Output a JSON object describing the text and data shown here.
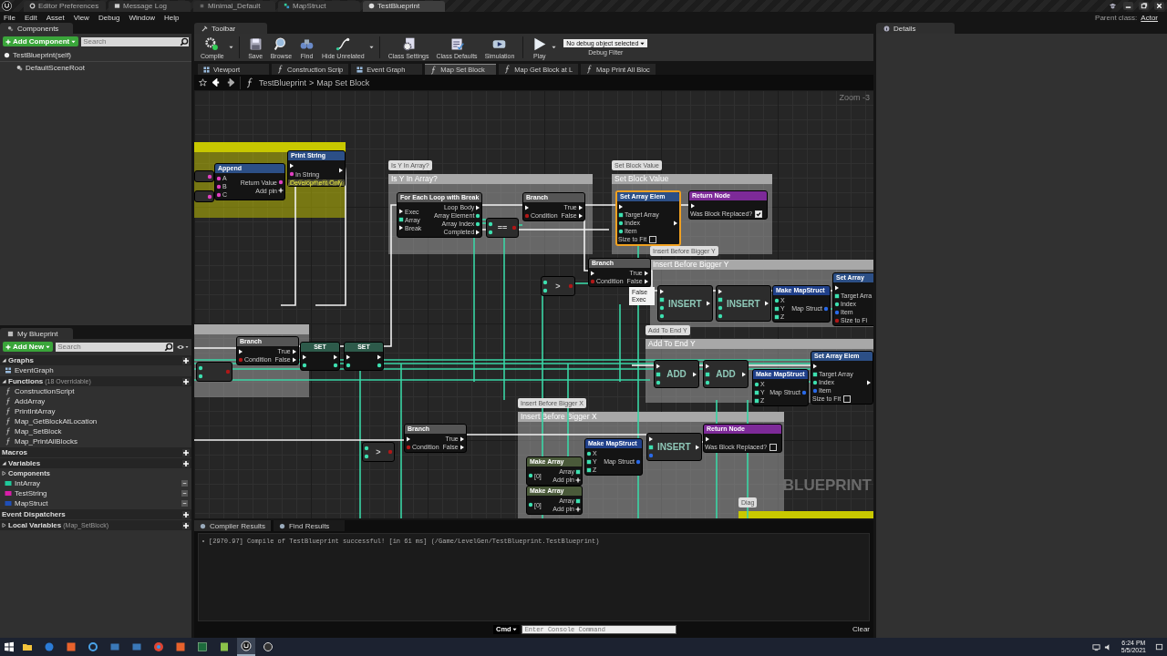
{
  "title_bar": {
    "tabs": [
      {
        "label": "Editor Preferences",
        "kind": "settings",
        "selected": false
      },
      {
        "label": "Message Log",
        "kind": "log",
        "selected": false
      },
      {
        "label": "Minimal_Default",
        "kind": "level",
        "selected": false
      },
      {
        "label": "MapStruct",
        "kind": "struct",
        "selected": false
      },
      {
        "label": "TestBlueprint",
        "kind": "blueprint",
        "selected": true
      }
    ]
  },
  "menu": [
    "File",
    "Edit",
    "Asset",
    "View",
    "Debug",
    "Window",
    "Help"
  ],
  "parent_class": {
    "label": "Parent class:",
    "value": "Actor"
  },
  "components": {
    "tab": "Components",
    "add_button": "Add Component",
    "search": {
      "placeholder": "Search"
    },
    "tree": [
      {
        "label": "TestBlueprint(self)",
        "kind": "self",
        "children": [
          {
            "label": "DefaultSceneRoot",
            "kind": "scene"
          }
        ]
      }
    ]
  },
  "my_blueprint": {
    "tab": "My Blueprint",
    "add_button": "Add New",
    "search": {
      "placeholder": "Search"
    },
    "sections": [
      {
        "title": "Graphs",
        "expanded": true,
        "items": [
          {
            "label": "EventGraph",
            "kind": "graph"
          }
        ]
      },
      {
        "title": "Functions",
        "note": "(18 Overridable)",
        "expanded": true,
        "items": [
          {
            "label": "ConstructionScript",
            "kind": "construction"
          },
          {
            "label": "AddArray",
            "kind": "function"
          },
          {
            "label": "PrintIntArray",
            "kind": "function"
          },
          {
            "label": "Map_GetBlockAtLocation",
            "kind": "function"
          },
          {
            "label": "Map_SetBlock",
            "kind": "function"
          },
          {
            "label": "Map_PrintAllBlocks",
            "kind": "function"
          }
        ]
      },
      {
        "title": "Macros"
      },
      {
        "title": "Variables",
        "expanded": true,
        "items": [
          {
            "label": "Components",
            "kind": "category"
          },
          {
            "label": "IntArray",
            "kind": "variable",
            "color": "#1fc99a"
          },
          {
            "label": "TestString",
            "kind": "variable",
            "color": "#d81ea8"
          },
          {
            "label": "MapStruct",
            "kind": "variable",
            "color": "#1f4fb8"
          }
        ]
      },
      {
        "title": "Event Dispatchers"
      },
      {
        "title": "Local Variables",
        "note": "(Map_SetBlock)",
        "expanded": false
      }
    ]
  },
  "toolbar": {
    "tab": "Toolbar",
    "buttons": [
      {
        "label": "Compile",
        "kind": "compile",
        "dropdown": true
      },
      {
        "label": "Save",
        "kind": "save",
        "dropdown": false
      },
      {
        "label": "Browse",
        "kind": "browse",
        "dropdown": false
      },
      {
        "label": "Find",
        "kind": "find",
        "dropdown": false
      },
      {
        "label": "Hide Unrelated",
        "kind": "hide",
        "dropdown": true
      },
      {
        "label": "Class Settings",
        "kind": "settings",
        "dropdown": false
      },
      {
        "label": "Class Defaults",
        "kind": "defaults",
        "dropdown": false
      },
      {
        "label": "Simulation",
        "kind": "simulation",
        "dropdown": false
      },
      {
        "label": "Play",
        "kind": "play",
        "dropdown": true
      }
    ],
    "debug": {
      "value": "No debug object selected",
      "label": "Debug Filter"
    }
  },
  "graph_tabs": [
    {
      "label": "Viewport",
      "kind": "viewport",
      "selected": false
    },
    {
      "label": "Construction Scrip",
      "kind": "function",
      "selected": false
    },
    {
      "label": "Event Graph",
      "kind": "event",
      "selected": false
    },
    {
      "label": "Map Set Block",
      "kind": "function",
      "selected": true
    },
    {
      "label": "Map Get Block at L",
      "kind": "function",
      "selected": false
    },
    {
      "label": "Map Print All Bloc",
      "kind": "function",
      "selected": false
    }
  ],
  "breadcrumb": {
    "parent": "TestBlueprint",
    "separator": ">",
    "current": "Map Set Block"
  },
  "graph": {
    "zoom": "Zoom -3",
    "watermark": "BLUEPRINT",
    "comments": [
      {
        "color": "#c8c800"
      },
      {
        "title": "Is Y In Array?",
        "bubble": "Is Y In Array?",
        "color": "#a8a8a8"
      },
      {
        "title": "Set Block Value",
        "bubble": "Set Block Value",
        "color": "#a8a8a8"
      },
      {
        "title": "Insert Before Bigger Y",
        "bubble": "Insert Before Bigger Y",
        "color": "#a8a8a8"
      },
      {
        "color": "#a8a8a8"
      },
      {
        "title": "Add To End Y",
        "bubble": "Add To End Y",
        "color": "#a8a8a8"
      },
      {
        "title": "Insert Before Bigger X",
        "bubble": "Insert Before Bigger X",
        "color": "#a8a8a8"
      },
      {
        "bubble": "Diag",
        "color": "#c8c800"
      }
    ],
    "nodes": [
      {
        "kind": "stub",
        "selected": false,
        "outputs": [
          {
            "kind": "string"
          }
        ]
      },
      {
        "kind": "stub",
        "selected": false,
        "outputs": [
          {
            "kind": "string"
          }
        ]
      },
      {
        "kind": "function",
        "title": "Append",
        "selected": false,
        "inputs": [
          {
            "label": "A",
            "kind": "string"
          },
          {
            "label": "B",
            "kind": "string"
          },
          {
            "label": "C",
            "kind": "string"
          }
        ],
        "outputs": [
          {
            "label": "Return Value",
            "kind": "string"
          },
          {
            "label": "Add pin",
            "kind": "add"
          }
        ]
      },
      {
        "kind": "function",
        "title": "Print String",
        "selected": false,
        "footer": "Development Only",
        "inputs": [
          {
            "kind": "exec"
          },
          {
            "label": "In String",
            "kind": "string"
          }
        ],
        "outputs": [
          {
            "kind": "exec"
          }
        ]
      },
      {
        "kind": "macro",
        "title": "For Each Loop with Break",
        "selected": false,
        "inputs": [
          {
            "label": "Exec",
            "kind": "exec"
          },
          {
            "label": "Array",
            "kind": "array"
          },
          {
            "label": "Break",
            "kind": "exec"
          }
        ],
        "outputs": [
          {
            "label": "Loop Body",
            "kind": "exec"
          },
          {
            "label": "Array Element",
            "kind": "int"
          },
          {
            "label": "Array Index",
            "kind": "int"
          },
          {
            "label": "Completed",
            "kind": "exec"
          }
        ]
      },
      {
        "kind": "operator",
        "title": "==",
        "selected": false,
        "inputs": [
          {
            "kind": "int"
          },
          {
            "kind": "int"
          }
        ],
        "outputs": [
          {
            "kind": "bool"
          }
        ]
      },
      {
        "kind": "branch",
        "title": "Branch",
        "selected": false,
        "inputs": [
          {
            "kind": "exec"
          },
          {
            "label": "Condition",
            "kind": "bool"
          }
        ],
        "outputs": [
          {
            "label": "True",
            "kind": "exec"
          },
          {
            "label": "False",
            "kind": "exec"
          }
        ]
      },
      {
        "kind": "function",
        "title": "Set Array Elem",
        "selected": true,
        "checkbox": {
          "label": "Size to Fit",
          "checked": false
        },
        "inputs": [
          {
            "kind": "exec"
          },
          {
            "label": "Target Array",
            "kind": "array"
          },
          {
            "label": "Index",
            "kind": "int"
          },
          {
            "label": "Item",
            "kind": "int"
          }
        ],
        "outputs": [
          {
            "kind": "exec"
          }
        ]
      },
      {
        "kind": "return",
        "title": "Return Node",
        "selected": false,
        "checkbox": {
          "label": "Was Block Replaced?",
          "checked": true
        },
        "inputs": [
          {
            "kind": "exec"
          }
        ]
      },
      {
        "kind": "branch",
        "title": "Branch",
        "selected": false,
        "inputs": [
          {
            "kind": "exec"
          },
          {
            "label": "Condition",
            "kind": "bool"
          }
        ],
        "outputs": [
          {
            "label": "True",
            "kind": "exec"
          },
          {
            "label": "False",
            "kind": "exec"
          }
        ]
      },
      {
        "kind": "operator",
        "title": ">",
        "selected": false,
        "inputs": [
          {
            "kind": "int"
          },
          {
            "kind": "int"
          }
        ],
        "outputs": [
          {
            "kind": "bool"
          }
        ]
      },
      {
        "kind": "compact",
        "title": "INSERT",
        "selected": false,
        "inputs": [
          {
            "kind": "exec"
          },
          {
            "kind": "array"
          },
          {
            "kind": "int"
          },
          {
            "kind": "int"
          }
        ],
        "outputs": [
          {
            "kind": "exec"
          }
        ]
      },
      {
        "kind": "compact",
        "title": "INSERT",
        "selected": false,
        "inputs": [
          {
            "kind": "exec"
          },
          {
            "kind": "array"
          },
          {
            "kind": "int"
          },
          {
            "kind": "int"
          }
        ],
        "outputs": [
          {
            "kind": "exec"
          }
        ]
      },
      {
        "kind": "struct",
        "title": "Make MapStruct",
        "selected": false,
        "inputs": [
          {
            "label": "X",
            "kind": "int"
          },
          {
            "label": "Y",
            "kind": "array"
          },
          {
            "label": "Z",
            "kind": "array"
          }
        ],
        "outputs": [
          {
            "label": "Map Struct",
            "kind": "struct"
          }
        ]
      },
      {
        "kind": "function",
        "title": "Set Array",
        "selected": false,
        "inputs": [
          {
            "kind": "exec"
          },
          {
            "label": "Target Arra",
            "kind": "array"
          },
          {
            "label": "Index",
            "kind": "int"
          },
          {
            "label": "Item",
            "kind": "struct"
          },
          {
            "label": "Size to Fi",
            "kind": "bool"
          }
        ]
      },
      {
        "kind": "branch",
        "title": "Branch",
        "selected": false,
        "inputs": [
          {
            "kind": "exec"
          },
          {
            "label": "Condition",
            "kind": "bool"
          }
        ],
        "outputs": [
          {
            "label": "True",
            "kind": "exec"
          },
          {
            "label": "False",
            "kind": "exec"
          }
        ]
      },
      {
        "kind": "operator",
        "selected": false,
        "inputs": [
          {
            "kind": "int"
          },
          {
            "kind": "int"
          }
        ],
        "outputs": [
          {
            "kind": "bool"
          }
        ]
      },
      {
        "kind": "set",
        "title": "SET",
        "selected": false,
        "inputs": [
          {
            "kind": "exec"
          },
          {
            "kind": "int"
          }
        ],
        "outputs": [
          {
            "kind": "exec"
          },
          {
            "kind": "int"
          }
        ]
      },
      {
        "kind": "set",
        "title": "SET",
        "selected": false,
        "inputs": [
          {
            "kind": "exec"
          },
          {
            "kind": "int"
          }
        ],
        "outputs": [
          {
            "kind": "exec"
          },
          {
            "kind": "int"
          }
        ]
      },
      {
        "kind": "compact",
        "title": "ADD",
        "selected": false,
        "inputs": [
          {
            "kind": "exec"
          },
          {
            "kind": "array"
          },
          {
            "kind": "int"
          }
        ],
        "outputs": [
          {
            "kind": "exec"
          }
        ]
      },
      {
        "kind": "compact",
        "title": "ADD",
        "selected": false,
        "inputs": [
          {
            "kind": "exec"
          },
          {
            "kind": "array"
          },
          {
            "kind": "int"
          }
        ],
        "outputs": [
          {
            "kind": "exec"
          }
        ]
      },
      {
        "kind": "struct",
        "title": "Make MapStruct",
        "selected": false,
        "inputs": [
          {
            "label": "X",
            "kind": "int"
          },
          {
            "label": "Y",
            "kind": "array"
          },
          {
            "label": "Z",
            "kind": "array"
          }
        ],
        "outputs": [
          {
            "label": "Map Struct",
            "kind": "struct"
          }
        ]
      },
      {
        "kind": "function",
        "title": "Set Array Elem",
        "selected": false,
        "checkbox": {
          "label": "Size to Fit",
          "checked": false
        },
        "inputs": [
          {
            "kind": "exec"
          },
          {
            "label": "Target Array",
            "kind": "array"
          },
          {
            "label": "Index",
            "kind": "int"
          },
          {
            "label": "Item",
            "kind": "struct"
          }
        ],
        "outputs": [
          {
            "kind": "exec"
          }
        ]
      },
      {
        "kind": "operator",
        "title": ">",
        "selected": false,
        "inputs": [
          {
            "kind": "int"
          },
          {
            "kind": "int"
          }
        ],
        "outputs": [
          {
            "kind": "bool"
          }
        ]
      },
      {
        "kind": "branch",
        "title": "Branch",
        "selected": false,
        "inputs": [
          {
            "kind": "exec"
          },
          {
            "label": "Condition",
            "kind": "bool"
          }
        ],
        "outputs": [
          {
            "label": "True",
            "kind": "exec"
          },
          {
            "label": "False",
            "kind": "exec"
          }
        ]
      },
      {
        "kind": "struct",
        "title": "Make MapStruct",
        "selected": false,
        "inputs": [
          {
            "label": "X",
            "kind": "int"
          },
          {
            "label": "Y",
            "kind": "array"
          },
          {
            "label": "Z",
            "kind": "array"
          }
        ],
        "outputs": [
          {
            "label": "Map Struct",
            "kind": "struct"
          }
        ]
      },
      {
        "kind": "compact",
        "title": "INSERT",
        "selected": false,
        "inputs": [
          {
            "kind": "exec"
          },
          {
            "kind": "array"
          },
          {
            "kind": "struct"
          }
        ],
        "outputs": [
          {
            "kind": "exec"
          }
        ]
      },
      {
        "kind": "return",
        "title": "Return Node",
        "selected": false,
        "checkbox": {
          "label": "Was Block Replaced?",
          "checked": false
        },
        "inputs": [
          {
            "kind": "exec"
          }
        ]
      },
      {
        "kind": "array",
        "title": "Make Array",
        "selected": false,
        "inputs": [
          {
            "label": "[0]",
            "kind": "int"
          }
        ],
        "outputs": [
          {
            "label": "Array",
            "kind": "array"
          },
          {
            "label": "Add pin",
            "kind": "add"
          }
        ]
      },
      {
        "kind": "array",
        "title": "Make Array",
        "selected": false,
        "inputs": [
          {
            "label": "[0]",
            "kind": "int"
          }
        ],
        "outputs": [
          {
            "label": "Array",
            "kind": "array"
          },
          {
            "label": "Add pin",
            "kind": "add"
          }
        ]
      }
    ],
    "tooltip": "False Exec"
  },
  "output": {
    "tabs": [
      {
        "label": "Compiler Results",
        "selected": true
      },
      {
        "label": "Find Results",
        "selected": false
      }
    ],
    "messages": [
      "[2970.97] Compile of TestBlueprint successful! [in 61 ms] (/Game/LevelGen/TestBlueprint.TestBlueprint)"
    ],
    "cmd": "Cmd",
    "console": {
      "placeholder": "Enter Console Command"
    },
    "clear": "Clear"
  },
  "details": {
    "tab": "Details"
  },
  "taskbar": {
    "apps": [
      {
        "kind": "folder",
        "selected": false
      },
      {
        "kind": "circle",
        "selected": false
      },
      {
        "kind": "square",
        "selected": false
      },
      {
        "kind": "ring",
        "selected": false
      },
      {
        "kind": "window",
        "selected": false
      },
      {
        "kind": "window",
        "selected": false
      },
      {
        "kind": "browser",
        "selected": false
      },
      {
        "kind": "square",
        "selected": false
      },
      {
        "kind": "sheet",
        "selected": false
      },
      {
        "kind": "image",
        "selected": false
      },
      {
        "kind": "engine",
        "selected": true
      },
      {
        "kind": "disc",
        "selected": false
      }
    ],
    "time": "6:24 PM",
    "date": "5/5/2021"
  }
}
